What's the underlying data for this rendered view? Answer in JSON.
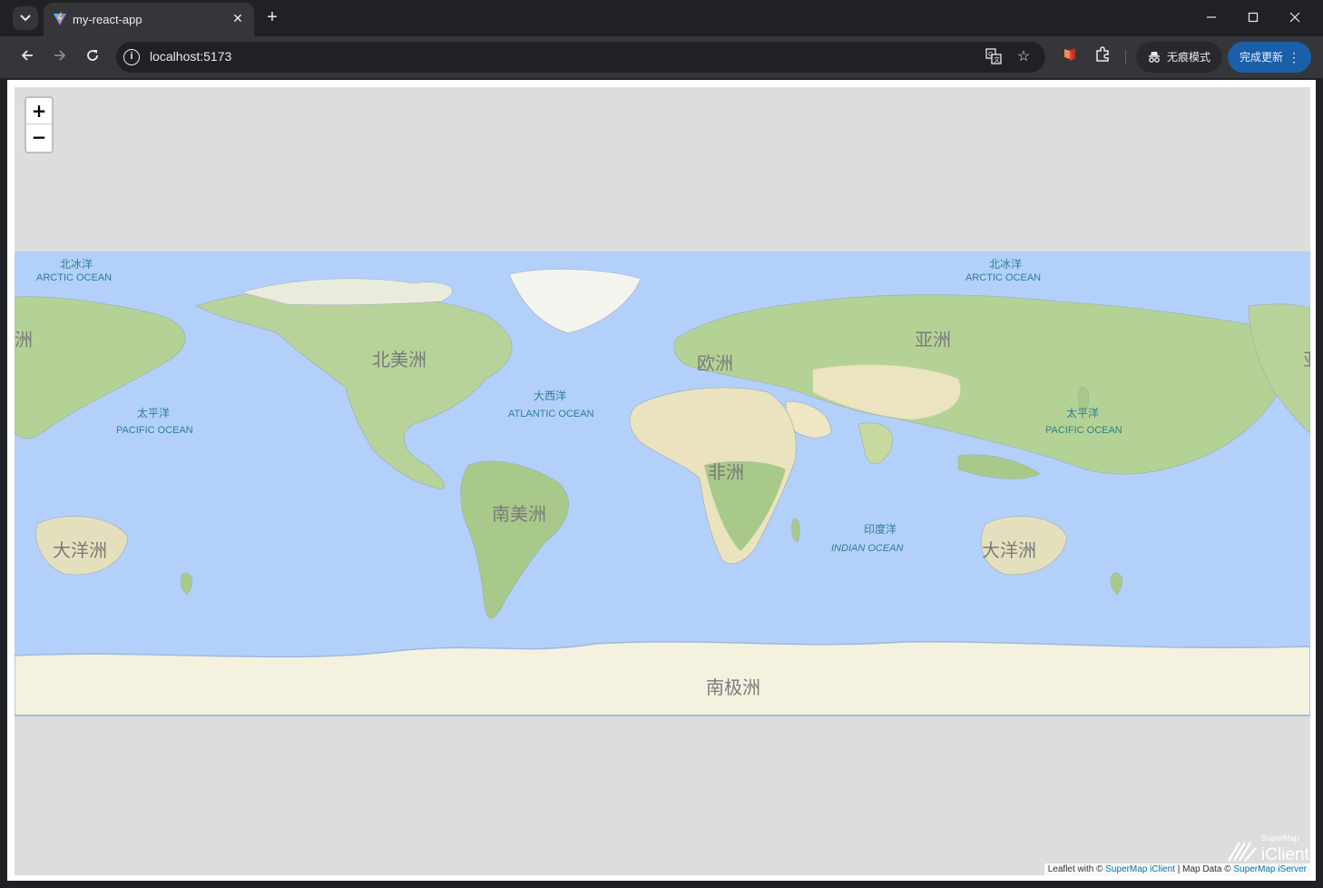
{
  "browser": {
    "tab_title": "my-react-app",
    "url": "localhost:5173",
    "incognito_label": "无痕模式",
    "update_label": "完成更新",
    "icons": [
      "tab-search-icon",
      "vite-favicon-icon",
      "close-icon",
      "plus-icon",
      "minimize-icon",
      "maximize-icon",
      "close-window-icon",
      "back-icon",
      "forward-icon",
      "reload-icon",
      "info-icon",
      "translate-icon",
      "star-icon",
      "extension-icon",
      "puzzle-icon",
      "incognito-icon",
      "more-vert-icon"
    ]
  },
  "map": {
    "zoom_in": "+",
    "zoom_out": "−",
    "continents": {
      "asia": "亚洲",
      "asia_left_fragment": "洲",
      "asia_right_fragment": "亚",
      "north_america": "北美洲",
      "south_america": "南美洲",
      "europe": "欧洲",
      "africa": "非洲",
      "oceania_left": "大洋洲",
      "oceania_right": "大洋洲",
      "antarctica": "南极洲"
    },
    "oceans": {
      "arctic_cn_left": "北冰洋",
      "arctic_en_left": "ARCTIC OCEAN",
      "arctic_cn_right": "北冰洋",
      "arctic_en_right": "ARCTIC OCEAN",
      "pacific_cn_left": "太平洋",
      "pacific_en_left": "PACIFIC OCEAN",
      "pacific_cn_right": "太平洋",
      "pacific_en_right": "PACIFIC OCEAN",
      "atlantic_cn": "大西洋",
      "atlantic_en": "ATLANTIC OCEAN",
      "indian_cn": "印度洋",
      "indian_en": "INDIAN OCEAN"
    },
    "attribution": {
      "prefix": "Leaflet with © ",
      "link1": "SuperMap iClient",
      "middle": " | Map Data © ",
      "link2": "SuperMap iServer"
    },
    "logo_small": "SuperMap",
    "logo_big": "iClient",
    "colors": {
      "ocean": "#aacbff",
      "land_green": "#a9c98a",
      "land_tan": "#efe8c8",
      "ice": "#f4f1df",
      "background": "#dddddd"
    }
  }
}
